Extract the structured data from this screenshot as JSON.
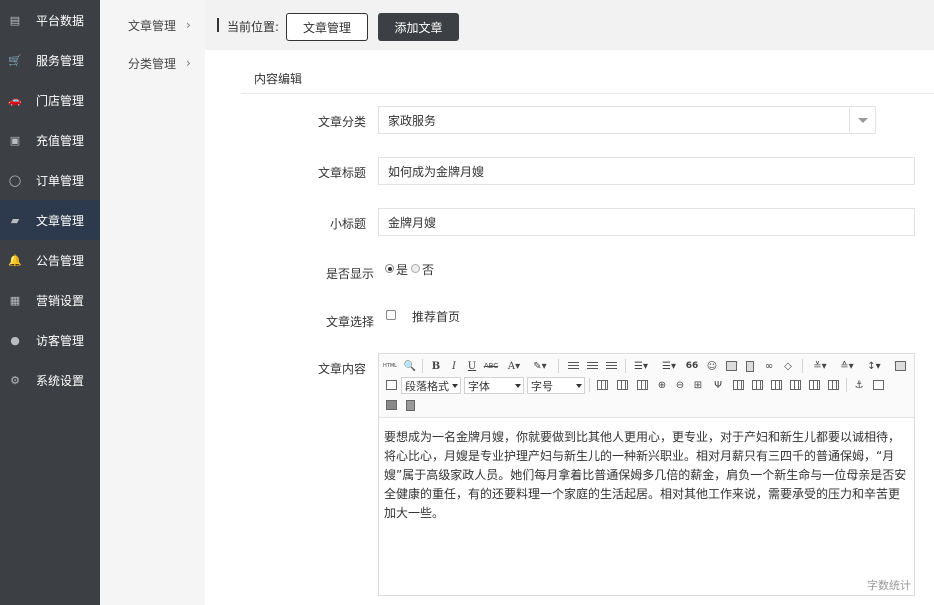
{
  "sidebar": {
    "items": [
      {
        "label": "平台数据",
        "icon": "dashboard-icon",
        "glyph": "▤"
      },
      {
        "label": "服务管理",
        "icon": "cart-icon",
        "glyph": "🛒"
      },
      {
        "label": "门店管理",
        "icon": "car-icon",
        "glyph": "🚗"
      },
      {
        "label": "充值管理",
        "icon": "money-icon",
        "glyph": "▣"
      },
      {
        "label": "订单管理",
        "icon": "comment-icon",
        "glyph": "◯"
      },
      {
        "label": "文章管理",
        "icon": "book-icon",
        "glyph": "▰",
        "active": true
      },
      {
        "label": "公告管理",
        "icon": "bell-icon",
        "glyph": "🔔"
      },
      {
        "label": "营销设置",
        "icon": "gift-icon",
        "glyph": "▦"
      },
      {
        "label": "访客管理",
        "icon": "user-icon",
        "glyph": "●"
      },
      {
        "label": "系统设置",
        "icon": "gear-icon",
        "glyph": "⚙"
      }
    ]
  },
  "submenu": {
    "items": [
      {
        "label": "文章管理",
        "arrow": "›"
      },
      {
        "label": "分类管理",
        "arrow": "›"
      }
    ]
  },
  "topbar": {
    "location_label": "当前位置:",
    "breadcrumb_button": "文章管理",
    "add_button": "添加文章"
  },
  "panel": {
    "title": "内容编辑"
  },
  "form": {
    "category_label": "文章分类",
    "category_value": "家政服务",
    "title_label": "文章标题",
    "title_value": "如何成为金牌月嫂",
    "subtitle_label": "小标题",
    "subtitle_value": "金牌月嫂",
    "display_label": "是否显示",
    "display_yes": "是",
    "display_no": "否",
    "display_selected": "是",
    "choice_label": "文章选择",
    "choice_option": "推荐首页",
    "choice_checked": false,
    "content_label": "文章内容"
  },
  "editor": {
    "paragraph_select": "段落格式",
    "font_select": "字体",
    "size_select": "字号",
    "content": "要想成为一名金牌月嫂，你就要做到比其他人更用心，更专业，对于产妇和新生儿都要以诚相待，将心比心，月嫂是专业护理产妇与新生儿的一种新兴职业。相对月薪只有三四千的普通保姆，“月嫂”属于高级家政人员。她们每月拿着比普通保姆多几倍的薪金，肩负一个新生命与一位母亲是否安全健康的重任，有的还要料理一个家庭的生活起居。相对其他工作来说，需要承受的压力和辛苦更加大一些。",
    "word_count_label": "字数统计",
    "toolbar_text": {
      "html": "HTML",
      "bold": "B",
      "italic": "I",
      "underline": "U",
      "strike": "ABC",
      "fontcolor": "A",
      "quote": "66"
    }
  }
}
